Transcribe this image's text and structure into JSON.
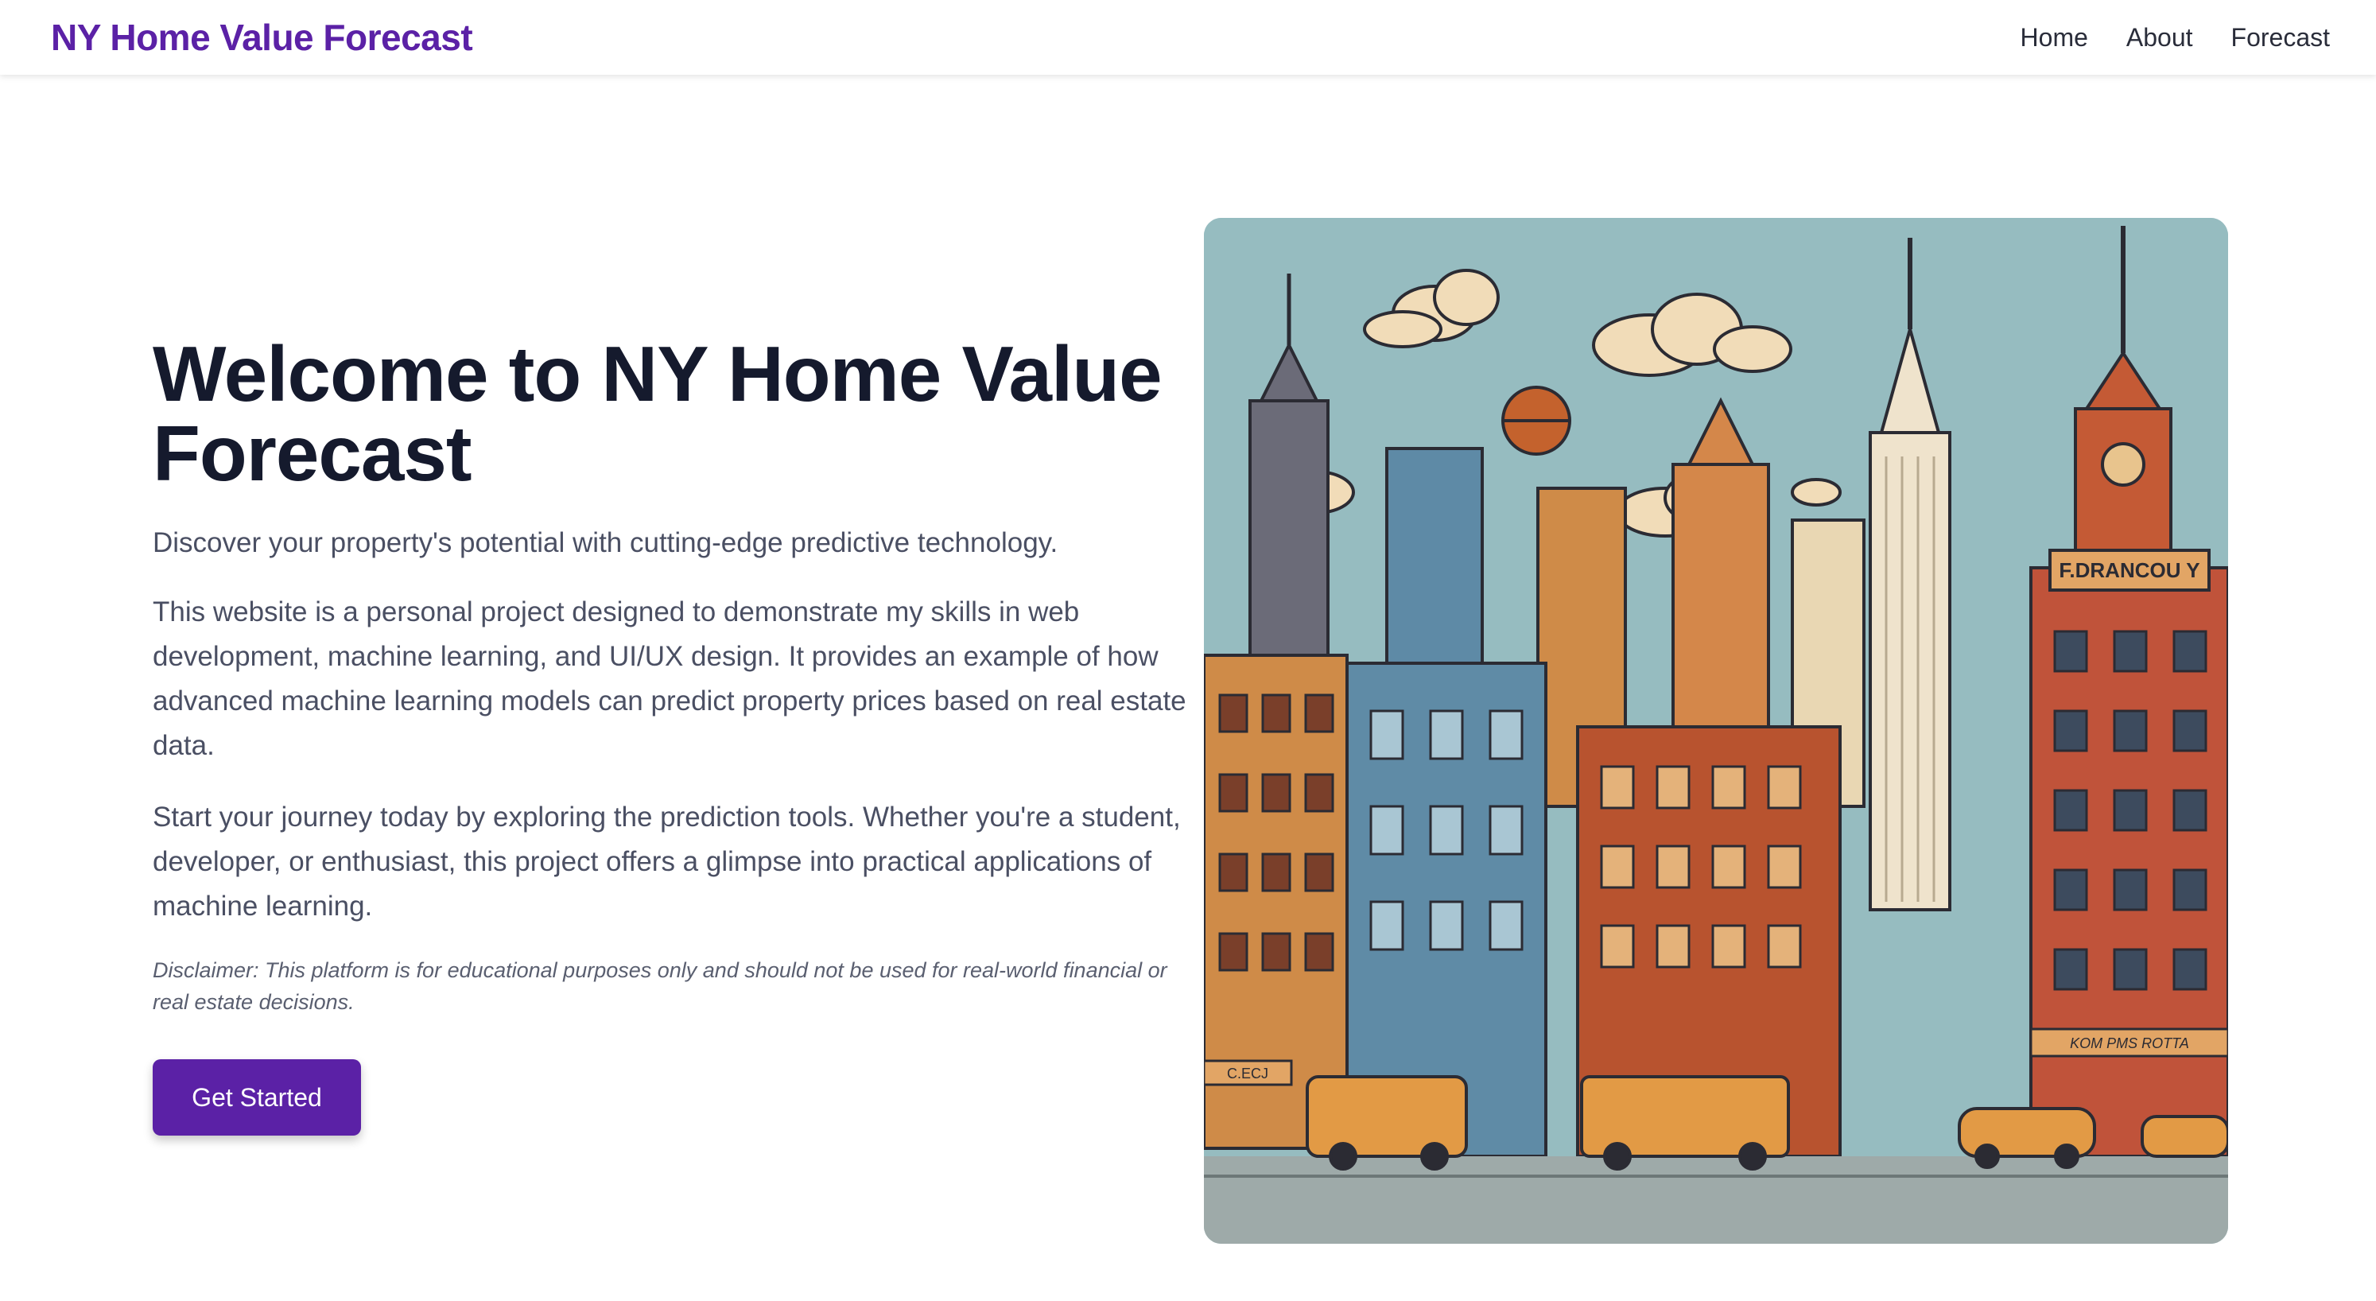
{
  "nav": {
    "brand": "NY Home Value Forecast",
    "links": [
      {
        "label": "Home"
      },
      {
        "label": "About"
      },
      {
        "label": "Forecast"
      }
    ]
  },
  "hero": {
    "title": "Welcome to NY Home Value Forecast",
    "tagline": "Discover your property's potential with cutting-edge predictive technology.",
    "paragraph1": "This website is a personal project designed to demonstrate my skills in web development, machine learning, and UI/UX design. It provides an example of how advanced machine learning models can predict property prices based on real estate data.",
    "paragraph2": "Start your journey today by exploring the prediction tools. Whether you're a student, developer, or enthusiast, this project offers a glimpse into practical applications of machine learning.",
    "disclaimer": "Disclaimer: This platform is for educational purposes only and should not be used for real-world financial or real estate decisions.",
    "cta_label": "Get Started"
  },
  "illustration": {
    "sign_text": "F.DRANCOU Y",
    "awning_text": "KOM PMS ROTTA",
    "store_text": "C.ECJ"
  },
  "colors": {
    "accent": "#5b21a6",
    "heading": "#151a2d",
    "body_text": "#4a4f63"
  }
}
